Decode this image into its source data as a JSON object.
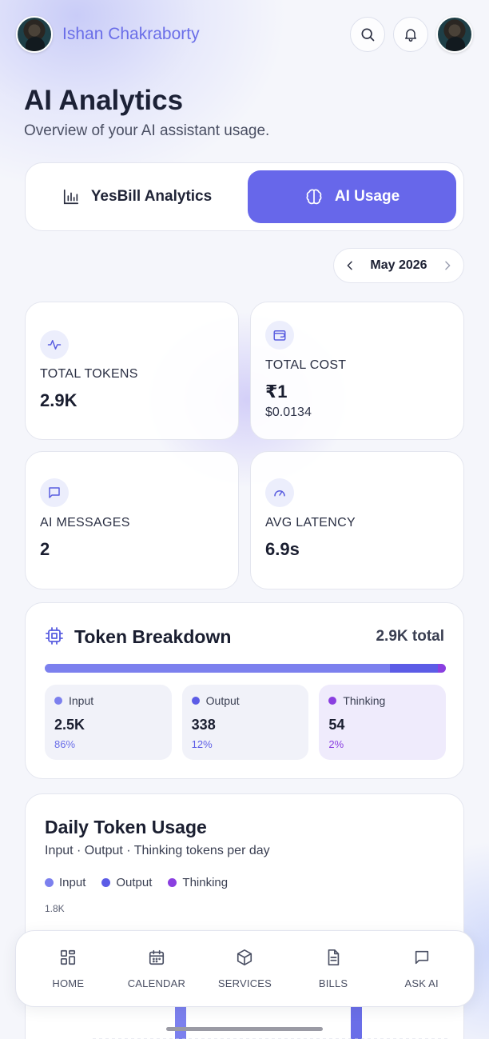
{
  "header": {
    "user_name": "Ishan Chakraborty"
  },
  "page": {
    "title": "AI Analytics",
    "subtitle": "Overview of your AI assistant usage."
  },
  "tabs": [
    {
      "label": "YesBill Analytics",
      "icon": "bar-chart-icon",
      "active": false
    },
    {
      "label": "AI Usage",
      "icon": "brain-icon",
      "active": true
    }
  ],
  "month_picker": {
    "label": "May 2026"
  },
  "stats": {
    "total_tokens": {
      "label": "TOTAL TOKENS",
      "value": "2.9K",
      "icon": "activity-icon"
    },
    "total_cost": {
      "label": "TOTAL COST",
      "value": "₹1",
      "subvalue": "$0.0134",
      "icon": "wallet-icon"
    },
    "ai_messages": {
      "label": "AI MESSAGES",
      "value": "2",
      "icon": "message-icon"
    },
    "avg_latency": {
      "label": "AVG LATENCY",
      "value": "6.9s",
      "icon": "gauge-icon"
    }
  },
  "breakdown": {
    "title": "Token Breakdown",
    "total": "2.9K total",
    "items": [
      {
        "name": "Input",
        "value": "2.5K",
        "pct": "86%",
        "share": 86,
        "color": "#7c80ee",
        "pct_color": "#6a6ee8"
      },
      {
        "name": "Output",
        "value": "338",
        "pct": "12%",
        "share": 12,
        "color": "#5c5ce6",
        "pct_color": "#5c5ce6"
      },
      {
        "name": "Thinking",
        "value": "54",
        "pct": "2%",
        "share": 2,
        "color": "#8a3fe0",
        "pct_color": "#8a3fe0"
      }
    ]
  },
  "daily": {
    "title": "Daily Token Usage",
    "subtitle": "Input · Output · Thinking tokens per day",
    "legend": [
      {
        "name": "Input",
        "color": "#7c80ee"
      },
      {
        "name": "Output",
        "color": "#5c5ce6"
      },
      {
        "name": "Thinking",
        "color": "#8a3fe0"
      }
    ],
    "y_tick_top": "1.8K"
  },
  "nav": [
    {
      "label": "HOME",
      "icon": "home-icon"
    },
    {
      "label": "CALENDAR",
      "icon": "calendar-icon"
    },
    {
      "label": "SERVICES",
      "icon": "box-icon"
    },
    {
      "label": "BILLS",
      "icon": "document-icon"
    },
    {
      "label": "ASK AI",
      "icon": "chat-icon"
    }
  ],
  "colors": {
    "accent": "#6767ea",
    "brand_text": "#6a6ee8"
  }
}
